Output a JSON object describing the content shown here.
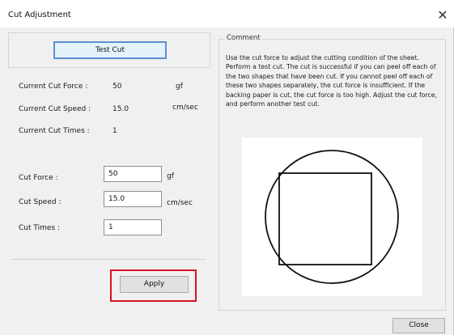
{
  "window": {
    "title": "Cut Adjustment",
    "close_glyph": "✕"
  },
  "test_cut": {
    "label": "Test Cut"
  },
  "current": {
    "force_label": "Current Cut Force :",
    "force_value": "50",
    "force_unit": "gf",
    "speed_label": "Current Cut Speed :",
    "speed_value": "15.0",
    "speed_unit": "cm/sec",
    "times_label": "Current Cut Times :",
    "times_value": "1"
  },
  "settings": {
    "force_label": "Cut Force :",
    "force_value": "50",
    "force_unit": "gf",
    "speed_label": "Cut Speed :",
    "speed_value": "15.0",
    "speed_unit": "cm/sec",
    "times_label": "Cut Times :",
    "times_value": "1"
  },
  "apply": {
    "label": "Apply",
    "highlight_color": "#d9121f"
  },
  "comment": {
    "legend": "Comment",
    "text": "Use the cut force to adjust the cutting condition of the sheet. Perform a test cut. The cut is successful if you can peel off each of the two shapes that have been cut. If you cannot peel off each of these two shapes separately, the cut force is insufficient. If the backing paper is cut, the cut force is too high. Adjust the cut force, and perform another test cut."
  },
  "illustration": {
    "shapes": [
      "circle",
      "square-inside-circle"
    ]
  },
  "footer": {
    "close_label": "Close"
  }
}
